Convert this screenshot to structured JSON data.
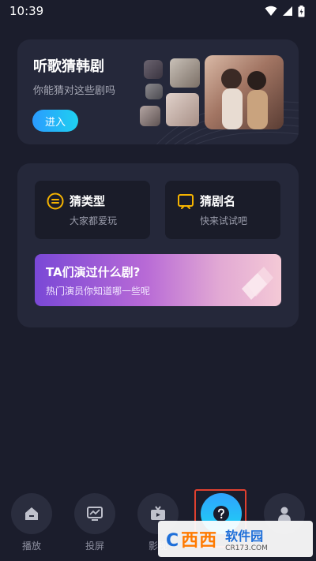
{
  "status": {
    "time": "10:39"
  },
  "banner": {
    "title": "听歌猜韩剧",
    "subtitle": "你能猜对这些剧吗",
    "button": "进入"
  },
  "games": {
    "guess_genre": {
      "title": "猜类型",
      "subtitle": "大家都爱玩"
    },
    "guess_drama": {
      "title": "猜剧名",
      "subtitle": "快来试试吧"
    },
    "actors": {
      "title": "TA们演过什么剧?",
      "subtitle": "热门演员你知道哪一些呢"
    }
  },
  "nav": {
    "items": [
      {
        "label": "播放",
        "icon": "home-icon"
      },
      {
        "label": "投屏",
        "icon": "cast-screen-icon"
      },
      {
        "label": "影视",
        "icon": "tv-icon"
      },
      {
        "label": "",
        "icon": "question-icon"
      },
      {
        "label": "",
        "icon": "user-icon"
      }
    ]
  },
  "watermark": {
    "logo": "西西",
    "name": "软件园",
    "url": "CR173.COM"
  },
  "colors": {
    "background": "#1b1d2c",
    "card": "#25283a",
    "accent_blue": "#2a9bff",
    "accent_yellow": "#f5b300",
    "highlight_red": "#e0402f"
  }
}
